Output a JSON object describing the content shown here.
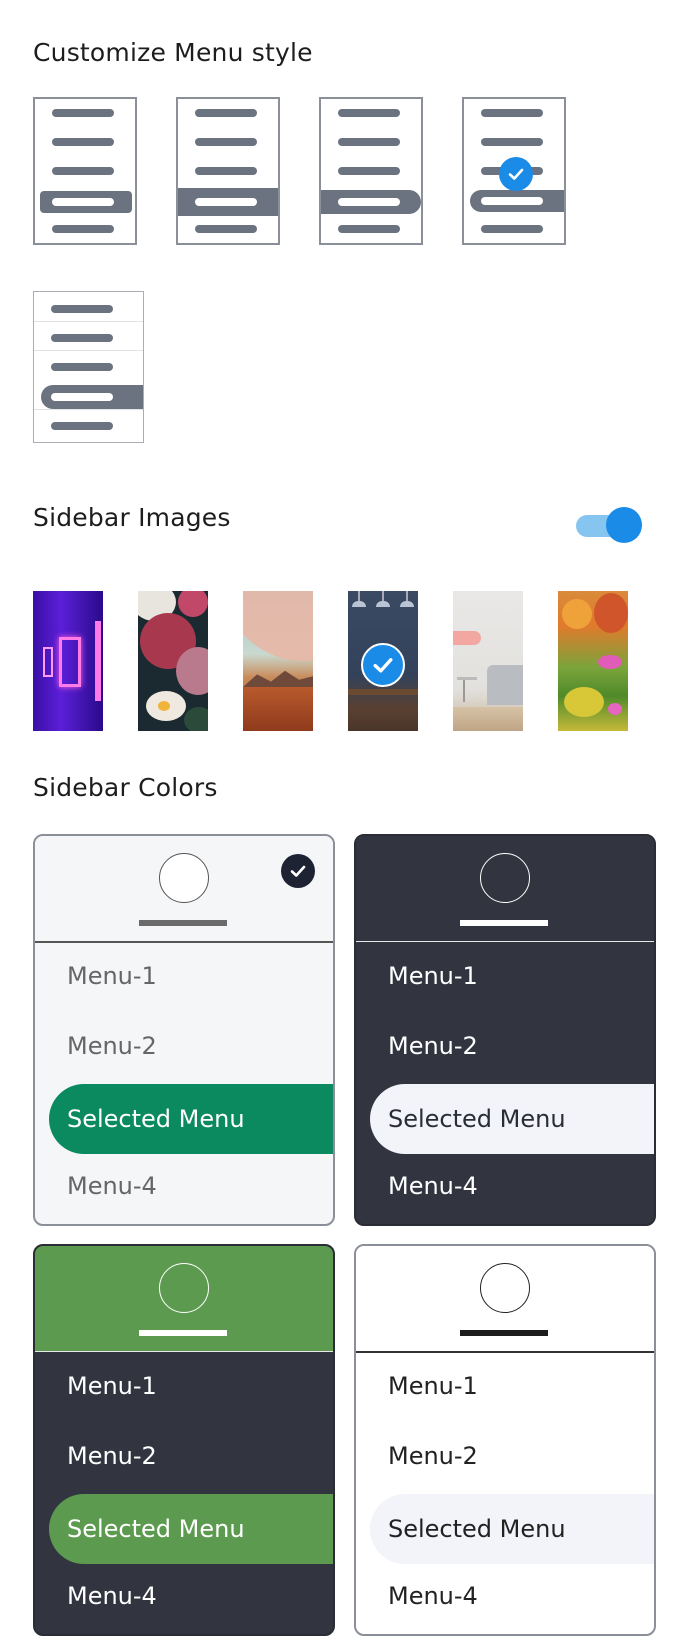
{
  "menu_style": {
    "title": "Customize Menu style",
    "options": [
      "style-1",
      "style-2",
      "style-3",
      "style-4",
      "style-5"
    ],
    "selected": "style-4"
  },
  "sidebar_images": {
    "title": "Sidebar Images",
    "enabled": true,
    "images": [
      "neon-corridor",
      "roses",
      "planet-desert",
      "blue-lamps-room",
      "white-room",
      "autumn-garden"
    ],
    "selected": "blue-lamps-room"
  },
  "sidebar_colors": {
    "title": "Sidebar Colors",
    "selected": "light",
    "cards": [
      {
        "id": "light",
        "items": [
          "Menu-1",
          "Menu-2",
          "Selected Menu",
          "Menu-4"
        ],
        "accent": "#0a8a5e",
        "bg": "#f5f6f8"
      },
      {
        "id": "dark",
        "items": [
          "Menu-1",
          "Menu-2",
          "Selected Menu",
          "Menu-4"
        ],
        "accent": "#f2f4fa",
        "bg": "#323540"
      },
      {
        "id": "green-dark",
        "items": [
          "Menu-1",
          "Menu-2",
          "Selected Menu",
          "Menu-4"
        ],
        "accent": "#5c9b4f",
        "bg": "#323540"
      },
      {
        "id": "white",
        "items": [
          "Menu-1",
          "Menu-2",
          "Selected Menu",
          "Menu-4"
        ],
        "accent": "#f2f4fa",
        "bg": "#ffffff"
      }
    ]
  }
}
